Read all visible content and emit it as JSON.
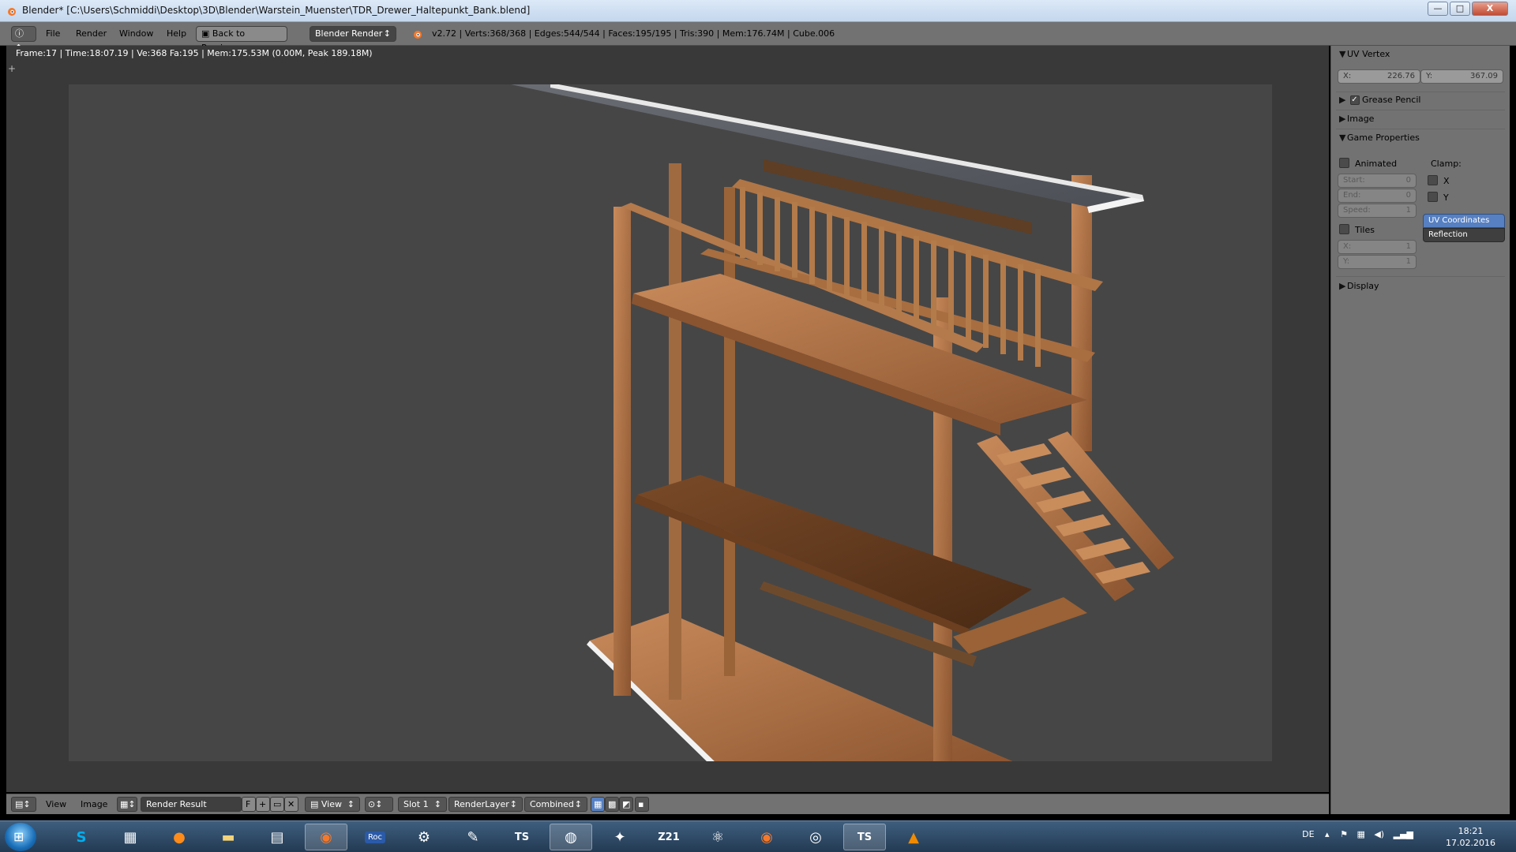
{
  "window": {
    "title": "Blender* [C:\\Users\\Schmiddi\\Desktop\\3D\\Blender\\Warstein_Muenster\\TDR_Drewer_Haltepunkt_Bank.blend]",
    "minimize": "—",
    "maximize": "□",
    "close": "X"
  },
  "header": {
    "menus": [
      "File",
      "Render",
      "Window",
      "Help"
    ],
    "back_button": "Back to Previous",
    "engine": "Blender Render",
    "stats": "v2.72 | Verts:368/368 | Edges:544/544 | Faces:195/195 | Tris:390 | Mem:176.74M | Cube.006"
  },
  "editor": {
    "render_status": "Frame:17 | Time:18:07.19 | Ve:368 Fa:195 | Mem:175.53M (0.00M, Peak 189.18M)",
    "plus": "+"
  },
  "bottom_header": {
    "view": "View",
    "image": "Image",
    "image_name": "Render Result",
    "fake_user": "F",
    "view_dropdown": "View",
    "slot": "Slot 1",
    "render_layer": "RenderLayer",
    "pass": "Combined"
  },
  "properties": {
    "uv_vertex": {
      "title": "UV Vertex",
      "x_label": "X:",
      "x_value": "226.76",
      "y_label": "Y:",
      "y_value": "367.09"
    },
    "grease_pencil": "Grease Pencil",
    "image": "Image",
    "game_properties": {
      "title": "Game Properties",
      "animated": "Animated",
      "clamp": "Clamp:",
      "start_label": "Start:",
      "start_value": "0",
      "end_label": "End:",
      "end_value": "0",
      "speed_label": "Speed:",
      "speed_value": "1",
      "clamp_x": "X",
      "clamp_y": "Y",
      "tiles": "Tiles",
      "tiles_x_label": "X:",
      "tiles_x_value": "1",
      "tiles_y_label": "Y:",
      "tiles_y_value": "1",
      "mapping_options": [
        "UV Coordinates",
        "Reflection"
      ],
      "mapping_selected": "UV Coordinates"
    },
    "display": "Display"
  },
  "taskbar": {
    "apps": [
      "skype",
      "control-panel",
      "firefox",
      "explorer",
      "notepad",
      "blender",
      "rocrail",
      "settings",
      "paint",
      "ts",
      "trainz",
      "gimp",
      "z21",
      "network",
      "blender2",
      "steam",
      "ts2",
      "vlc"
    ],
    "tray_lang": "DE",
    "time": "18:21",
    "date": "17.02.2016"
  },
  "colors": {
    "accent_blue": "#5680c2",
    "panel_bg": "#727272",
    "editor_bg": "#393939"
  }
}
